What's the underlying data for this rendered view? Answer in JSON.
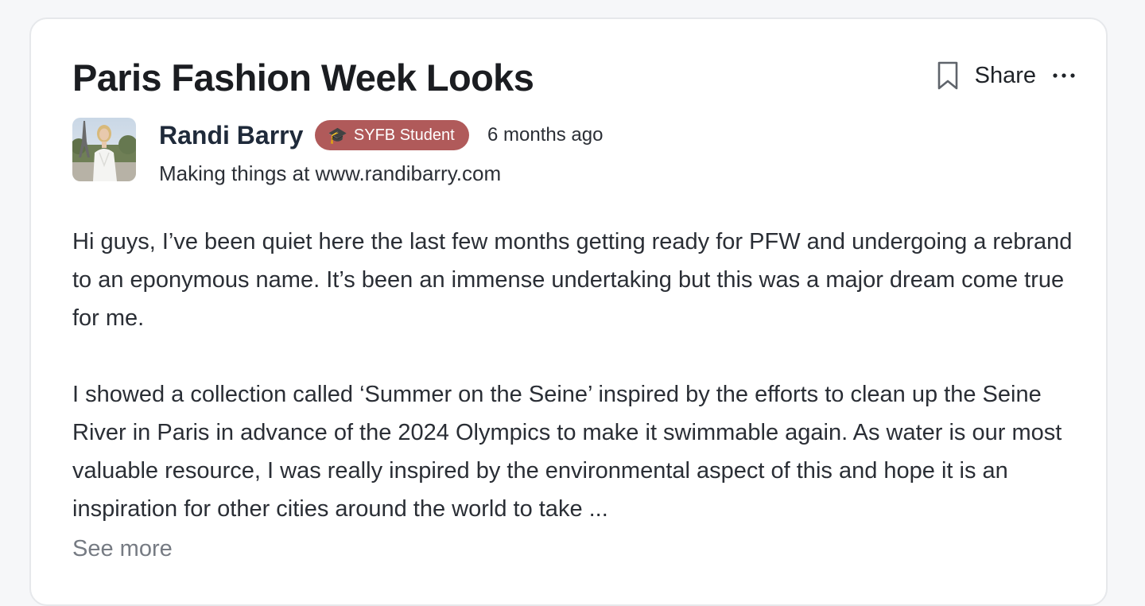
{
  "post": {
    "title": "Paris Fashion Week Looks",
    "actions": {
      "bookmark_icon": "bookmark-icon",
      "share_label": "Share",
      "more_icon": "more-horizontal-icon"
    },
    "author": {
      "name": "Randi Barry",
      "badge": "SYFB Student",
      "badge_icon": "🎓",
      "badge_color": "#b05a5a",
      "timestamp": "6 months ago",
      "bio": "Making things at www.randibarry.com"
    },
    "body": {
      "paragraph_1": "Hi guys, I’ve been quiet here the last few months getting ready for PFW and undergoing a rebrand to an eponymous name. It’s been an immense undertaking but this was a major dream come true for me.",
      "paragraph_2": "I showed a collection called ‘Summer on the Seine’ inspired by the efforts to clean up the Seine River in Paris in advance of the 2024 Olympics to make it swimmable again. As water is our most valuable resource, I was really inspired by the environmental aspect of this and hope it is an inspiration for other cities around the world to take ...",
      "see_more": "See more"
    }
  }
}
